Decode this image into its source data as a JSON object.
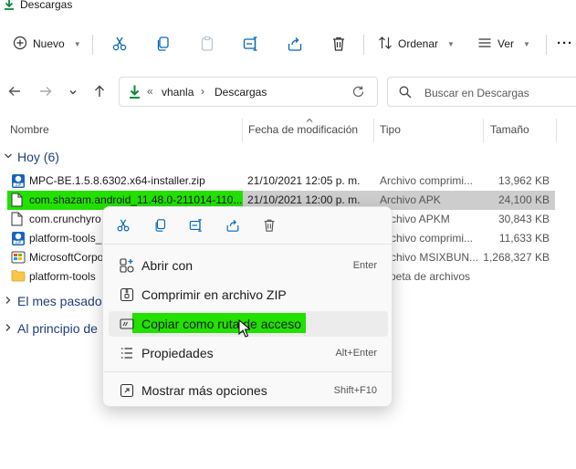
{
  "window": {
    "title": "Descargas"
  },
  "toolbar": {
    "new_label": "Nuevo",
    "sort_label": "Ordenar",
    "view_label": "Ver",
    "more_label": "···",
    "icons": [
      "cut-icon",
      "copy-icon",
      "paste-icon",
      "rename-icon",
      "share-icon",
      "delete-icon"
    ]
  },
  "address": {
    "overflow": "«",
    "crumbs": [
      "vhanla",
      "Descargas"
    ],
    "separator": "›"
  },
  "search": {
    "placeholder": "Buscar en Descargas"
  },
  "columns": {
    "name": "Nombre",
    "date": "Fecha de modificación",
    "type": "Tipo",
    "size": "Tamaño"
  },
  "groups": {
    "today": "Hoy (6)",
    "last_month": "El mes pasado",
    "start_year": "Al principio de"
  },
  "files": [
    {
      "name": "MPC-BE.1.5.8.6302.x64-installer.zip",
      "date": "21/10/2021 12:05 p. m.",
      "type": "Archivo comprimi...",
      "size": "13,962 KB",
      "icon": "zip-icon"
    },
    {
      "name": "com.shazam.android_11.48.0-211014-110...",
      "date": "21/10/2021 12:00 p. m.",
      "type": "Archivo APK",
      "size": "24,100 KB",
      "icon": "file-icon"
    },
    {
      "name": "com.crunchyro",
      "date": "",
      "type": "Archivo APKM",
      "size": "30,843 KB",
      "icon": "file-icon"
    },
    {
      "name": "platform-tools_",
      "date": "",
      "type": "Archivo comprimi...",
      "size": "11,633 KB",
      "icon": "zip-icon"
    },
    {
      "name": "MicrosoftCorpo",
      "date": "",
      "type": "Archivo MSIXBUN...",
      "size": "1,268,327 KB",
      "icon": "package-icon"
    },
    {
      "name": "platform-tools",
      "date": "",
      "type": "rpeta de archivos",
      "size": "",
      "icon": "folder-icon"
    }
  ],
  "context_menu": {
    "actions": [
      "cut-icon",
      "copy-icon",
      "rename-icon",
      "share-icon",
      "delete-icon"
    ],
    "items": [
      {
        "label": "Abrir con",
        "shortcut": "Enter",
        "icon": "open-with-icon"
      },
      {
        "label": "Comprimir en archivo ZIP",
        "shortcut": "",
        "icon": "zip-compress-icon"
      },
      {
        "label": "Copiar como ruta de acceso",
        "shortcut": "",
        "icon": "copy-path-icon"
      },
      {
        "label": "Propiedades",
        "shortcut": "Alt+Enter",
        "icon": "properties-icon"
      },
      {
        "label": "Mostrar más opciones",
        "shortcut": "Shift+F10",
        "icon": "more-options-icon"
      }
    ]
  },
  "colors": {
    "highlight": "#22e000",
    "selection": "#cdcdcd",
    "accent": "#0067c0",
    "download_green": "#0a8a3a"
  }
}
